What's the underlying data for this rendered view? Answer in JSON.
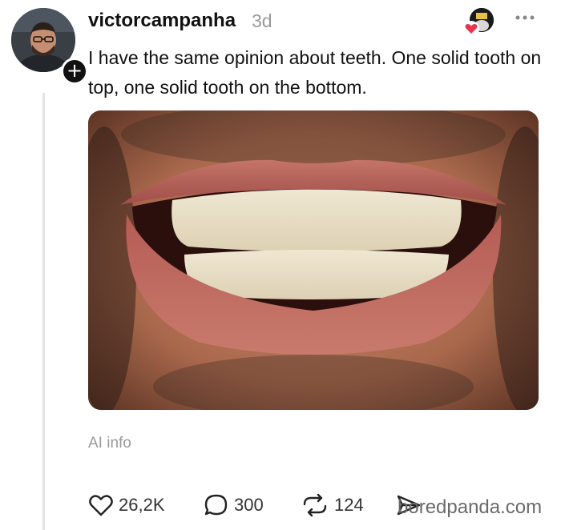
{
  "post": {
    "username": "victorcampanha",
    "timestamp": "3d",
    "text": "I have the same opinion about teeth. One solid tooth on top, one solid tooth on the bottom.",
    "ai_label": "AI info"
  },
  "actions": {
    "likes": "26,2K",
    "replies": "300",
    "reposts": "124"
  },
  "watermark": "boredpanda.com",
  "colors": {
    "like_heart": "#e8344e",
    "text_muted": "#999999",
    "thread_line": "#e3e3e3"
  }
}
